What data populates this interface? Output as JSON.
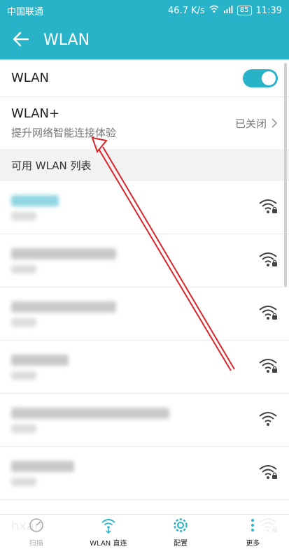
{
  "status_bar": {
    "carrier": "中国联通",
    "speed": "46.7 K/s",
    "battery": "85",
    "time": "11:39"
  },
  "app_bar": {
    "title": "WLAN"
  },
  "wlan_row": {
    "label": "WLAN",
    "enabled": true
  },
  "wlan_plus": {
    "title": "WLAN+",
    "subtitle": "提升网络智能连接体验",
    "status": "已关闭"
  },
  "available_header": "可用 WLAN 列表",
  "networks": [
    {
      "visible_name": "",
      "blurred": true,
      "accent": true,
      "locked": true
    },
    {
      "visible_name": "",
      "blurred": true,
      "accent": false,
      "locked": true
    },
    {
      "visible_name": "",
      "blurred": true,
      "accent": false,
      "locked": true
    },
    {
      "visible_name": "",
      "blurred": true,
      "accent": false,
      "locked": true
    },
    {
      "visible_name": "",
      "blurred": true,
      "accent": false,
      "locked": false
    },
    {
      "visible_name": "",
      "blurred": true,
      "accent": false,
      "locked": true
    },
    {
      "visible_name": "hxan",
      "blurred": false,
      "accent": false,
      "locked": true
    }
  ],
  "bottom_nav": [
    {
      "label": "扫描",
      "icon": "scan-icon",
      "enabled": false
    },
    {
      "label": "WLAN 直连",
      "icon": "wifi-direct-icon",
      "enabled": true
    },
    {
      "label": "配置",
      "icon": "gear-icon",
      "enabled": true
    },
    {
      "label": "更多",
      "icon": "more-icon",
      "enabled": true
    }
  ],
  "colors": {
    "accent": "#29b3c8",
    "annotation_arrow": "#d9262b"
  }
}
